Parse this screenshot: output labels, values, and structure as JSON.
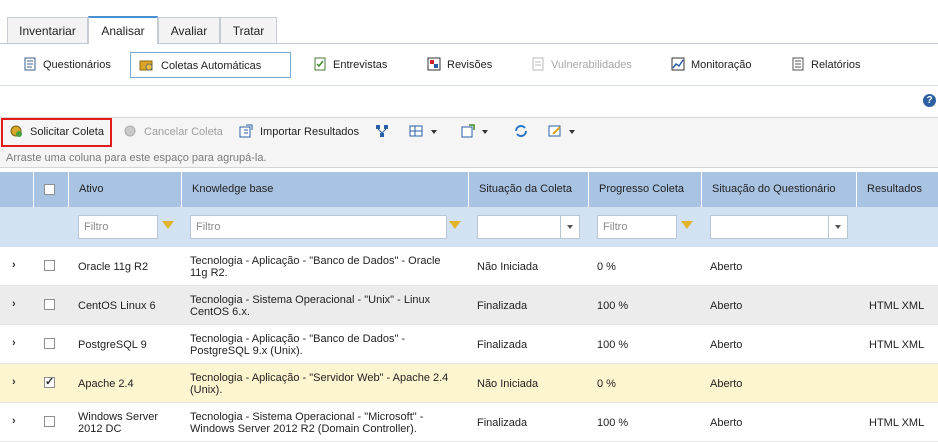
{
  "tabs": [
    "Inventariar",
    "Analisar",
    "Avaliar",
    "Tratar"
  ],
  "subnav": [
    {
      "label": "Questionários",
      "icon": "questionnaire-icon"
    },
    {
      "label": "Coletas Automáticas",
      "icon": "automatic-collection-icon"
    },
    {
      "label": "Entrevistas",
      "icon": "interview-icon"
    },
    {
      "label": "Revisões",
      "icon": "review-icon"
    },
    {
      "label": "Vulnerabilidades",
      "icon": "vulnerability-icon"
    },
    {
      "label": "Monitoração",
      "icon": "monitoring-icon"
    },
    {
      "label": "Relatórios",
      "icon": "report-icon"
    }
  ],
  "help": "?",
  "toolbar": {
    "request": "Solicitar Coleta",
    "cancel": "Cancelar Coleta",
    "import": "Importar Resultados"
  },
  "group_hint": "Arraste uma coluna para este espaço para agrupá-la.",
  "columns": [
    "Ativo",
    "Knowledge base",
    "Situação da Coleta",
    "Progresso Coleta",
    "Situação do Questionário",
    "Resultados"
  ],
  "filter_placeholder": "Filtro",
  "rows": [
    {
      "ativo": "Oracle 11g R2",
      "kb": "Tecnologia - Aplicação - \"Banco de Dados\" - Oracle 11g R2.",
      "situacao": "Não Iniciada",
      "progresso": "0 %",
      "questionario": "Aberto",
      "resultados": "",
      "checked": false
    },
    {
      "ativo": "CentOS Linux 6",
      "kb": "Tecnologia - Sistema Operacional - \"Unix\" - Linux CentOS 6.x.",
      "situacao": "Finalizada",
      "progresso": "100 %",
      "questionario": "Aberto",
      "resultados": "HTML XML",
      "checked": false
    },
    {
      "ativo": "PostgreSQL 9",
      "kb": "Tecnologia - Aplicação - \"Banco de Dados\" - PostgreSQL 9.x (Unix).",
      "situacao": "Finalizada",
      "progresso": "100 %",
      "questionario": "Aberto",
      "resultados": "HTML XML",
      "checked": false
    },
    {
      "ativo": "Apache 2.4",
      "kb": "Tecnologia - Aplicação - \"Servidor Web\" - Apache 2.4 (Unix).",
      "situacao": "Não Iniciada",
      "progresso": "0 %",
      "questionario": "Aberto",
      "resultados": "",
      "checked": true
    },
    {
      "ativo": "Windows Server 2012 DC",
      "kb": "Tecnologia - Sistema Operacional - \"Microsoft\" - Windows Server 2012 R2 (Domain Controller).",
      "situacao": "Finalizada",
      "progresso": "100 %",
      "questionario": "Aberto",
      "resultados": "HTML XML",
      "checked": false
    }
  ]
}
